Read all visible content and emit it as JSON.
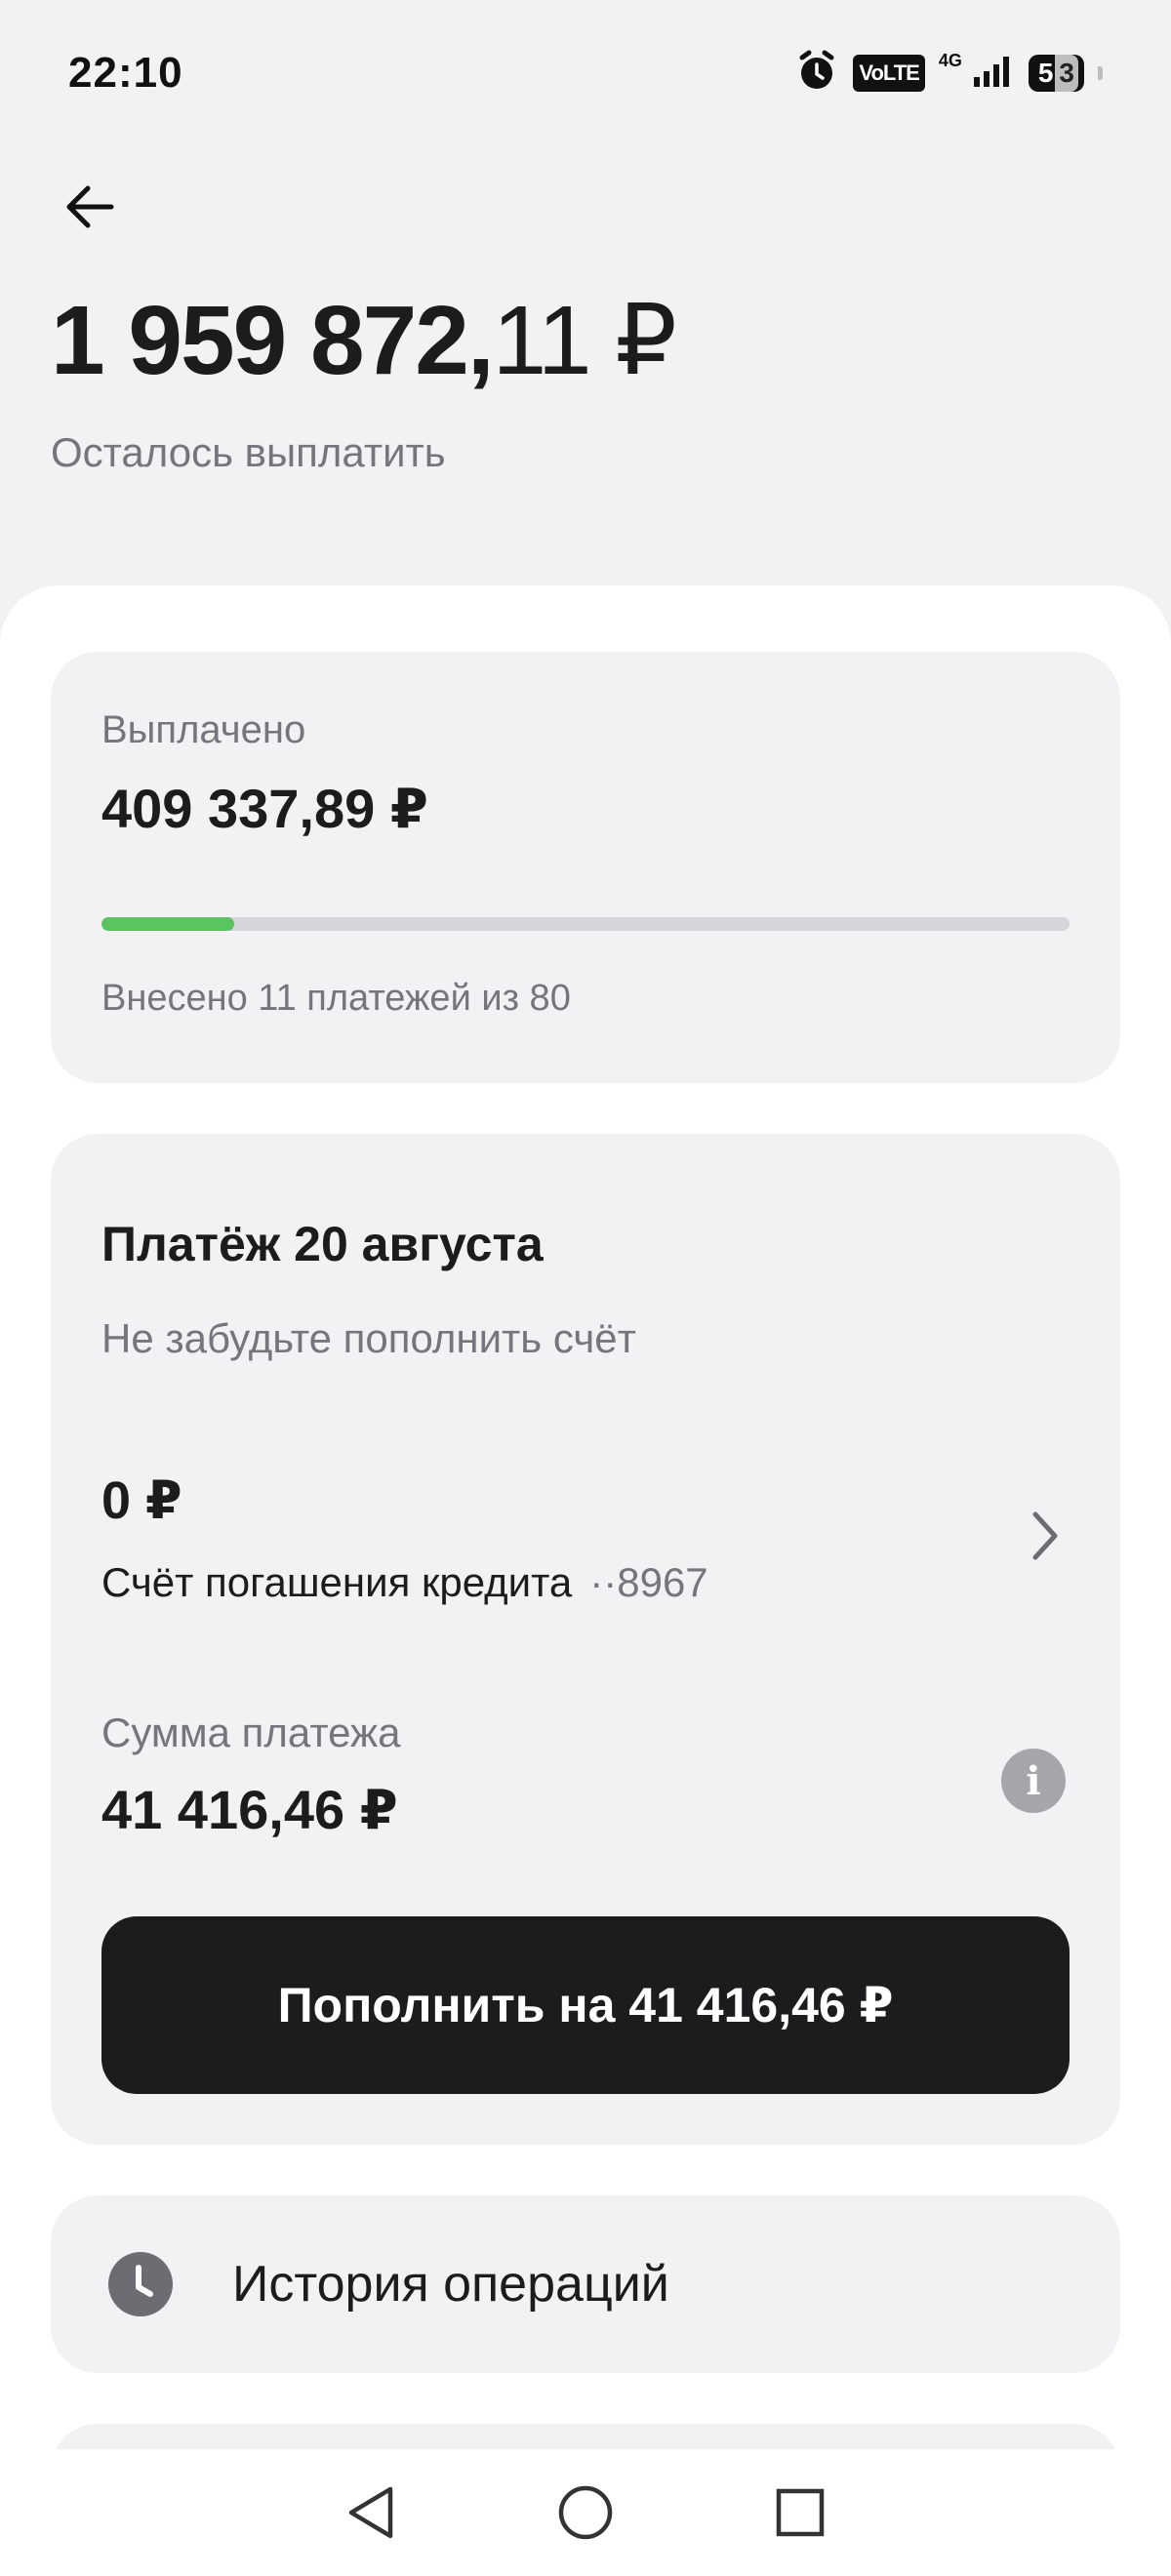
{
  "status_bar": {
    "time": "22:10",
    "volte": "VoLTE",
    "network": "4G",
    "battery_level": "53",
    "battery_digit_full": "5",
    "battery_digit_empty": "3",
    "icons": [
      "alarm-icon",
      "volte-icon",
      "signal-icon",
      "battery-icon"
    ]
  },
  "header": {
    "back_icon": "arrow-left-icon",
    "amount_main": "1 959 872,",
    "amount_kopecks": "11 ₽",
    "remaining_label": "Осталось выплатить"
  },
  "paid": {
    "label": "Выплачено",
    "value": "409 337,89 ₽",
    "progress_fraction": 0.1375,
    "progress_text": "Внесено 11 платежей из 80",
    "progress_color": "#5bc35f"
  },
  "payment": {
    "title": "Платёж 20 августа",
    "subtitle": "Не забудьте пополнить счёт",
    "account_amount": "0 ₽",
    "account_name": "Счёт погашения кредита",
    "account_mask": "··8967",
    "sum_label": "Сумма платежа",
    "sum_value": "41 416,46 ₽",
    "info_icon": "i",
    "topup_label": "Пополнить на 41 416,46 ₽"
  },
  "history": {
    "label": "История операций",
    "icon": "clock-icon"
  },
  "nav": {
    "buttons": [
      "back-triangle-icon",
      "home-circle-icon",
      "recents-square-icon"
    ]
  }
}
